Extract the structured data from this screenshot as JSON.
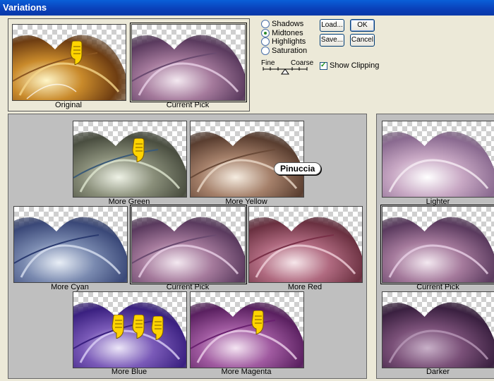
{
  "window": {
    "title": "Variations"
  },
  "colors": {
    "accent": "#0a3fb8",
    "grey_panel": "#bfbfbf",
    "radio_dot": "#2a8a2a"
  },
  "top": {
    "original_label": "Original",
    "current_label": "Current Pick"
  },
  "tone": {
    "options": [
      {
        "label": "Shadows",
        "selected": false
      },
      {
        "label": "Midtones",
        "selected": true
      },
      {
        "label": "Highlights",
        "selected": false
      },
      {
        "label": "Saturation",
        "selected": false
      }
    ],
    "fine_label": "Fine",
    "coarse_label": "Coarse"
  },
  "buttons": {
    "load": "Load...",
    "ok": "OK",
    "save": "Save...",
    "cancel": "Cancel"
  },
  "show_clipping": {
    "label": "Show Clipping",
    "checked": true
  },
  "variations": {
    "more_green": "More Green",
    "more_yellow": "More Yellow",
    "more_cyan": "More Cyan",
    "current_pick": "Current Pick",
    "more_red": "More Red",
    "more_blue": "More Blue",
    "more_magenta": "More Magenta"
  },
  "brightness": {
    "lighter": "Lighter",
    "current_pick": "Current Pick",
    "darker": "Darker"
  },
  "watermark": "Pinuccia",
  "icons": [
    "pointing-hand-icon"
  ]
}
